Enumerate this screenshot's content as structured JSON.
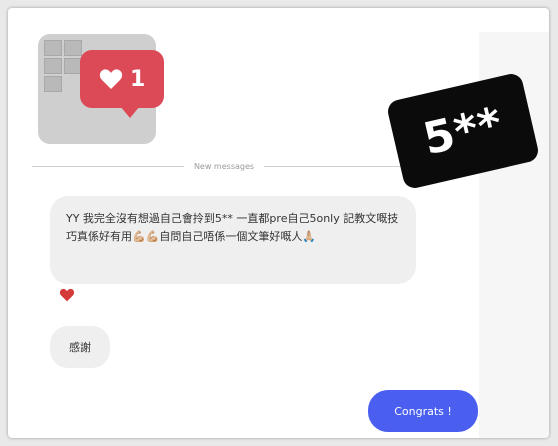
{
  "shared_post": {
    "like_count": "1"
  },
  "divider": {
    "label": "New messages"
  },
  "sticker": {
    "text": "5**"
  },
  "messages": [
    {
      "direction": "incoming",
      "text": "YY 我完全沒有想過自己會拎到5** 一直都pre自己5only 記教文嘅技巧真係好有用💪🏼💪🏼自問自己唔係一個文筆好嘅人🙏🏼",
      "reaction": "heart"
    },
    {
      "direction": "incoming",
      "text": "感謝"
    },
    {
      "direction": "outgoing",
      "text": "Congrats !"
    }
  ],
  "colors": {
    "like_badge": "#dd4a57",
    "outgoing_bubble": "#4a5ff0",
    "incoming_bubble": "#efefef",
    "reaction": "#d43a3a"
  }
}
